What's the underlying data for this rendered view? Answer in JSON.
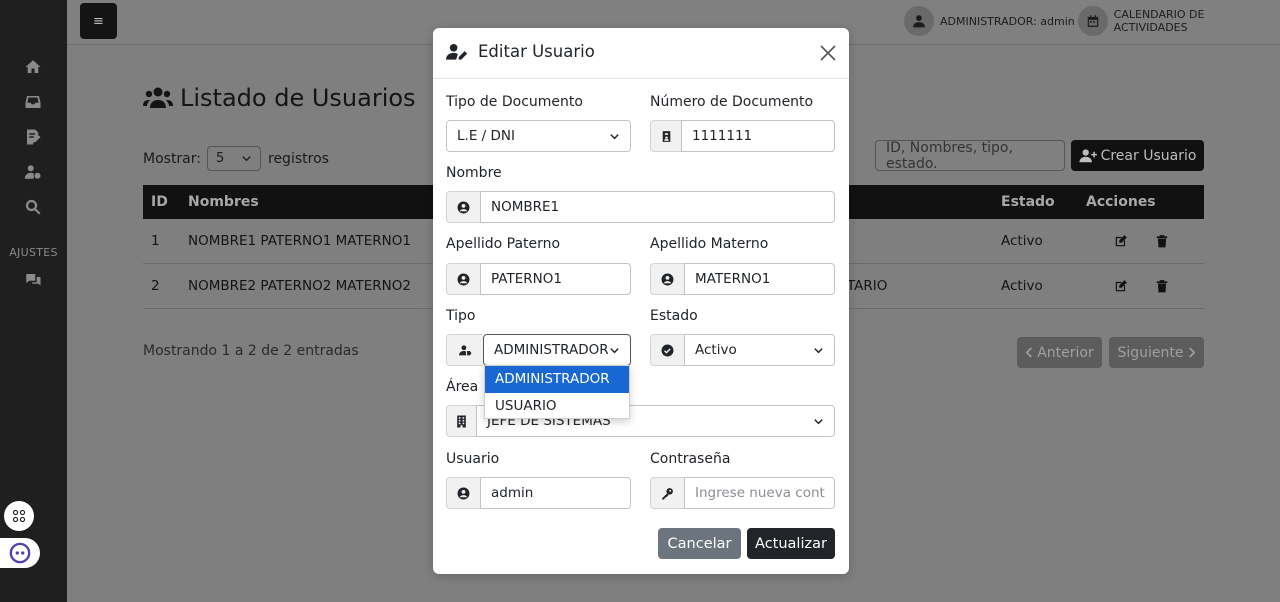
{
  "topbar": {
    "menu_glyph": "≡",
    "user_label": "ADMINISTRADOR: admin",
    "calendar_label": "CALENDARIO DE ACTIVIDADES"
  },
  "sidebar": {
    "section_label": "AJUSTES",
    "icons": [
      "home-icon",
      "inbox-icon",
      "edit-doc-icon",
      "user-gear-icon",
      "search-icon",
      "chat-icon"
    ]
  },
  "page": {
    "title": "Listado de Usuarios",
    "show_label": "Mostrar:",
    "show_value": "5",
    "records_label": "registros",
    "search_placeholder": "ID, Nombres, tipo, estado.",
    "create_button": "Crear Usuario",
    "table": {
      "headers": [
        "ID",
        "Nombres",
        "Estado",
        "Acciones"
      ],
      "rows": [
        {
          "id": "1",
          "name": "NOMBRE1 PATERNO1 MATERNO1",
          "tipo": "",
          "estado": "Activo"
        },
        {
          "id": "2",
          "name": "NOMBRE2 PATERNO2 MATERNO2",
          "tipo": "ITARIO",
          "estado": "Activo"
        }
      ]
    },
    "footer_info": "Mostrando 1 a 2 de 2 entradas",
    "prev_button": "Anterior",
    "next_button": "Siguiente"
  },
  "modal": {
    "title": "Editar Usuario",
    "tipo_documento": {
      "label": "Tipo de Documento",
      "value": "L.E / DNI"
    },
    "numero_documento": {
      "label": "Número de Documento",
      "value": "1111111"
    },
    "nombre": {
      "label": "Nombre",
      "value": "NOMBRE1"
    },
    "apellido_paterno": {
      "label": "Apellido Paterno",
      "value": "PATERNO1"
    },
    "apellido_materno": {
      "label": "Apellido Materno",
      "value": "MATERNO1"
    },
    "tipo": {
      "label": "Tipo",
      "value": "ADMINISTRADOR",
      "options": [
        "ADMINISTRADOR",
        "USUARIO"
      ]
    },
    "estado": {
      "label": "Estado",
      "value": "Activo"
    },
    "area": {
      "label": "Área",
      "value": "JEFE DE SISTEMAS"
    },
    "usuario": {
      "label": "Usuario",
      "value": "admin"
    },
    "contrasena": {
      "label": "Contraseña",
      "placeholder": "Ingrese nueva cont"
    },
    "cancel_button": "Cancelar",
    "update_button": "Actualizar"
  },
  "colors": {
    "primary_dark": "#212529",
    "selected_option": "#1967d2",
    "cancel": "#6c757d"
  }
}
